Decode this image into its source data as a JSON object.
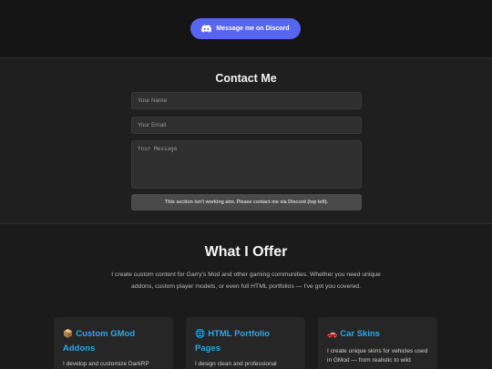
{
  "top": {
    "discord_button_label": "Message me on Discord"
  },
  "contact": {
    "title": "Contact Me",
    "name_placeholder": "Your Name",
    "email_placeholder": "Your Email",
    "message_placeholder": "Your Message",
    "notice": "This section isn't working atm. Please contact me via Discord (top left)."
  },
  "offer": {
    "title": "What I Offer",
    "description": "I create custom content for Garry's Mod and other gaming communities. Whether you need unique addons, custom player models, or even full HTML portfolios — I've got you covered.",
    "cards": [
      {
        "emoji": "📦",
        "title": "Custom GMod Addons",
        "text": "I develop and customize DarkRP"
      },
      {
        "emoji": "🌐",
        "title": "HTML Portfolio Pages",
        "text": "I design clean and professional"
      },
      {
        "emoji": "🚗",
        "title": "Car Skins",
        "text": "I create unique skins for vehicles used in GMod — from realistic to wild"
      }
    ]
  },
  "colors": {
    "discord": "#5865f2",
    "card_title": "#2fa7e6",
    "background": "#1b1b1b"
  }
}
